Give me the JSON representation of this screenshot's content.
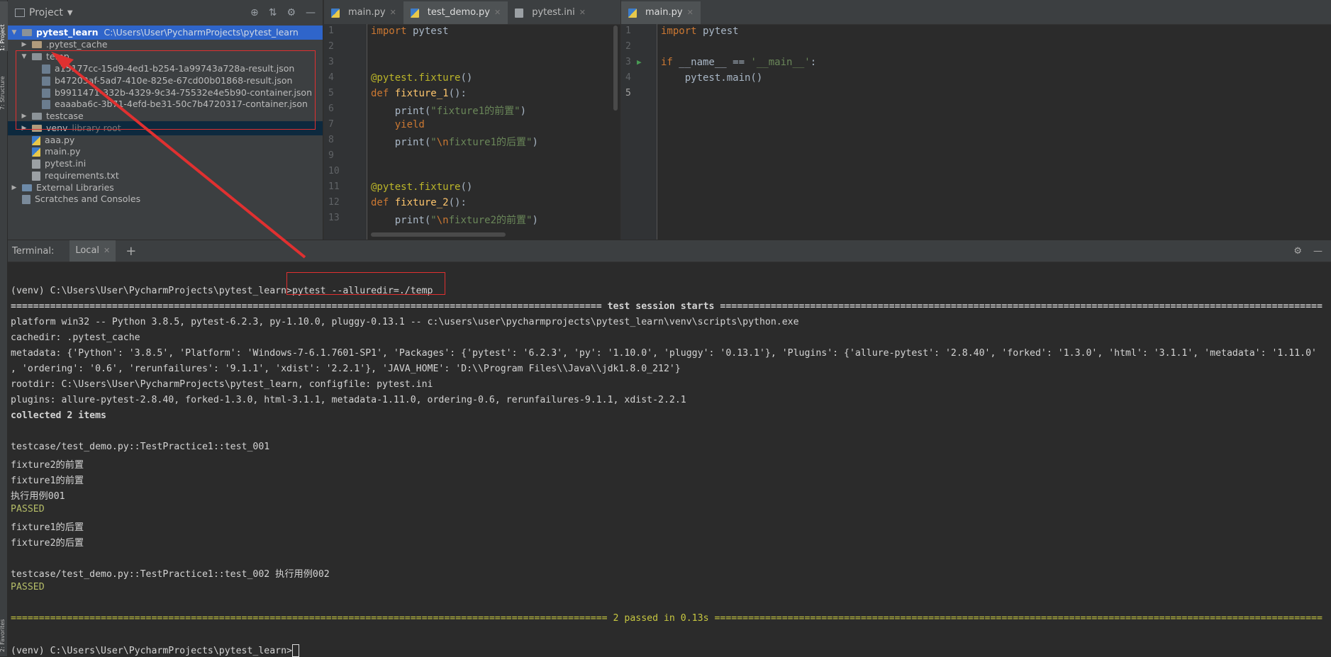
{
  "left_strip": {
    "project_tab": "1: Project",
    "structure_tab": "7: Structure",
    "favorites_tab": "2: Favorites"
  },
  "project": {
    "title": "Project",
    "tree": [
      {
        "label": "pytest_learn",
        "extra": "C:\\Users\\User\\PycharmProjects\\pytest_learn",
        "type": "folder",
        "level": 0,
        "arrow": "▼",
        "selected": true
      },
      {
        "label": ".pytest_cache",
        "type": "folder-excluded",
        "level": 1,
        "arrow": "▶"
      },
      {
        "label": "temp",
        "type": "folder",
        "level": 1,
        "arrow": "▼"
      },
      {
        "label": "a15177cc-15d9-4ed1-b254-1a99743a728a-result.json",
        "type": "json",
        "level": 2
      },
      {
        "label": "b47203af-5ad7-410e-825e-67cd00b01868-result.json",
        "type": "json",
        "level": 2
      },
      {
        "label": "b9911471-332b-4329-9c34-75532e4e5b90-container.json",
        "type": "json",
        "level": 2
      },
      {
        "label": "eaaaba6c-3b71-4efd-be31-50c7b4720317-container.json",
        "type": "json",
        "level": 2
      },
      {
        "label": "testcase",
        "type": "folder",
        "level": 1,
        "arrow": "▶"
      },
      {
        "label": "venv",
        "extra": "library root",
        "type": "folder-excluded",
        "level": 1,
        "arrow": "▶",
        "highlight": true
      },
      {
        "label": "aaa.py",
        "type": "py",
        "level": 1
      },
      {
        "label": "main.py",
        "type": "py",
        "level": 1
      },
      {
        "label": "pytest.ini",
        "type": "txt",
        "level": 1
      },
      {
        "label": "requirements.txt",
        "type": "txt",
        "level": 1
      },
      {
        "label": "External Libraries",
        "type": "lib",
        "level": 0,
        "arrow": "▶"
      },
      {
        "label": "Scratches and Consoles",
        "type": "scratch",
        "level": 0
      }
    ]
  },
  "editor1": {
    "tabs": [
      {
        "label": "main.py",
        "active": false
      },
      {
        "label": "test_demo.py",
        "active": true
      },
      {
        "label": "pytest.ini",
        "active": false
      }
    ],
    "line_numbers": [
      "1",
      "2",
      "3",
      "4",
      "5",
      "6",
      "7",
      "8",
      "9",
      "10",
      "11",
      "12",
      "13"
    ]
  },
  "editor2": {
    "tabs": [
      {
        "label": "main.py",
        "active": true
      }
    ],
    "line_numbers": [
      "1",
      "2",
      "3",
      "4",
      "5"
    ]
  },
  "terminal": {
    "label": "Terminal:",
    "tab": "Local",
    "lines": [
      "",
      "(venv) C:\\Users\\User\\PycharmProjects\\pytest_learn>pytest --alluredir=./temp",
      "========================================================================================================= test session starts ===========================================================================================================",
      "platform win32 -- Python 3.8.5, pytest-6.2.3, py-1.10.0, pluggy-0.13.1 -- c:\\users\\user\\pycharmprojects\\pytest_learn\\venv\\scripts\\python.exe",
      "cachedir: .pytest_cache",
      "metadata: {'Python': '3.8.5', 'Platform': 'Windows-7-6.1.7601-SP1', 'Packages': {'pytest': '6.2.3', 'py': '1.10.0', 'pluggy': '0.13.1'}, 'Plugins': {'allure-pytest': '2.8.40', 'forked': '1.3.0', 'html': '3.1.1', 'metadata': '1.11.0'",
      ", 'ordering': '0.6', 'rerunfailures': '9.1.1', 'xdist': '2.2.1'}, 'JAVA_HOME': 'D:\\\\Program Files\\\\Java\\\\jdk1.8.0_212'}",
      "rootdir: C:\\Users\\User\\PycharmProjects\\pytest_learn, configfile: pytest.ini",
      "plugins: allure-pytest-2.8.40, forked-1.3.0, html-3.1.1, metadata-1.11.0, ordering-0.6, rerunfailures-9.1.1, xdist-2.2.1",
      "collected 2 items",
      "",
      "testcase/test_demo.py::TestPractice1::test_001",
      "fixture2的前置",
      "fixture1的前置",
      "执行用例001",
      "PASSED",
      "fixture1的后置",
      "fixture2的后置",
      "",
      "testcase/test_demo.py::TestPractice1::test_002 执行用例002",
      "PASSED",
      "",
      "========================================================================================================== 2 passed in 0.13s ============================================================================================================",
      "",
      "(venv) C:\\Users\\User\\PycharmProjects\\pytest_learn>"
    ]
  },
  "colors": {
    "annotation_red": "#e03030",
    "passed_green": "#b5bd68"
  }
}
